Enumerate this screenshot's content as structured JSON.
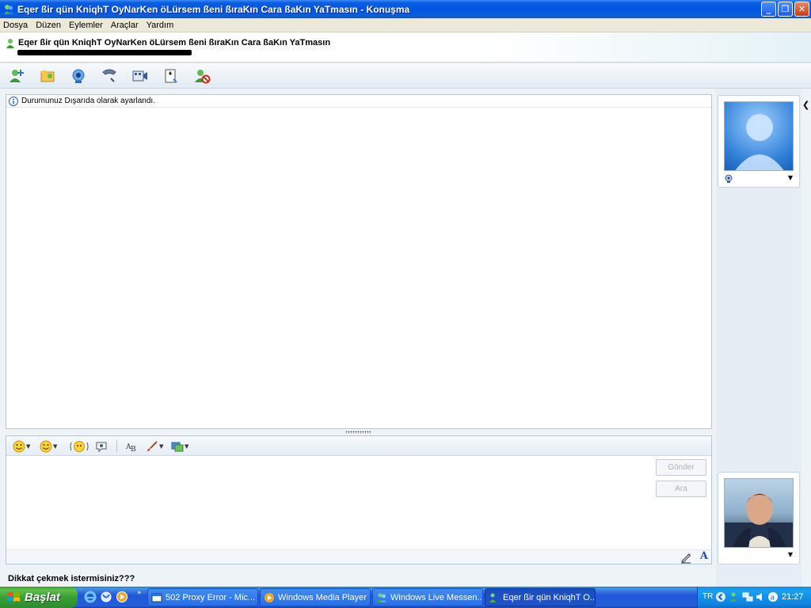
{
  "window": {
    "title": "Eqer ßir qün KniqhT OyNarKen öLürsem ßeni ßıraKın Cara ßaKın YaTmasın - Konuşma",
    "minimize_label": "_",
    "maximize_label": "❐",
    "close_label": "✕"
  },
  "menu": {
    "items": [
      "Dosya",
      "Düzen",
      "Eylemler",
      "Araçlar",
      "Yardım"
    ]
  },
  "contact": {
    "name": "Eqer ßir qün KniqhT OyNarKen öLürsem ßeni ßıraKın Cara ßaKın YaTmasın"
  },
  "toolbar": {
    "icons": [
      "invite-contact-icon",
      "send-files-icon",
      "webcam-icon",
      "call-icon",
      "video-call-icon",
      "activities-icon",
      "block-icon"
    ]
  },
  "history": {
    "status_message": "Durumunuz Dışarıda olarak ayarlandı."
  },
  "compose": {
    "text": "",
    "send_label": "Gönder",
    "search_label": "Ara",
    "format_icons": [
      "emoticon-icon",
      "wink-icon",
      "nudge-icon",
      "voice-clip-icon",
      "font-icon",
      "background-icon",
      "games-icon"
    ]
  },
  "nudge_prompt": "Dikkat çekmek istermisiniz???",
  "taskbar": {
    "start_label": "Başlat",
    "tasks": [
      {
        "label": "502 Proxy Error - Mic..."
      },
      {
        "label": "Windows Media Player"
      },
      {
        "label": "Windows Live Messen..."
      },
      {
        "label": "Eqer ßir qün KniqhT O..."
      }
    ],
    "language": "TR",
    "clock": "21:27"
  },
  "colors": {
    "titlebar": "#0054e3",
    "taskbar": "#245edb",
    "start_button": "#37a035",
    "panel_bg": "#eef3f8"
  }
}
